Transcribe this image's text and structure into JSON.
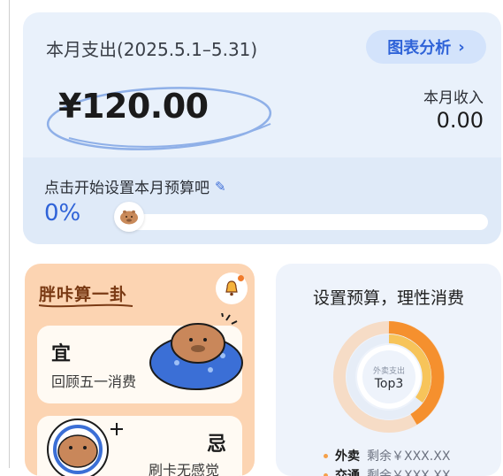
{
  "summary": {
    "period_label": "本月支出(2025.5.1–5.31)",
    "chart_button_label": "图表分析",
    "expense_amount": "¥120.00",
    "income_label": "本月收入",
    "income_value": "0.00",
    "budget_prompt": "点击开始设置本月预算吧",
    "budget_percent_text": "0%",
    "budget_progress": 0
  },
  "fortune": {
    "title": "胖咔算一卦",
    "good_char": "宜",
    "good_text": "回顾五一消费",
    "bad_char": "忌",
    "bad_text": "刷卡无感觉"
  },
  "budget_card": {
    "title": "设置预算，理性消费",
    "donut_small_label": "外卖支出",
    "donut_big_label": "Top3",
    "legend": [
      {
        "name": "外卖",
        "value": "剩余￥XXX.XX",
        "color": "#f5a04a"
      },
      {
        "name": "交通",
        "value": "剩余￥XXX.XX",
        "color": "#f5a04a"
      }
    ]
  },
  "colors": {
    "accent": "#2f63d8",
    "summary_bg": "#e9f1fb",
    "fortune_bg": "#fcd4b2",
    "donut_orange": "#f5a04a"
  }
}
